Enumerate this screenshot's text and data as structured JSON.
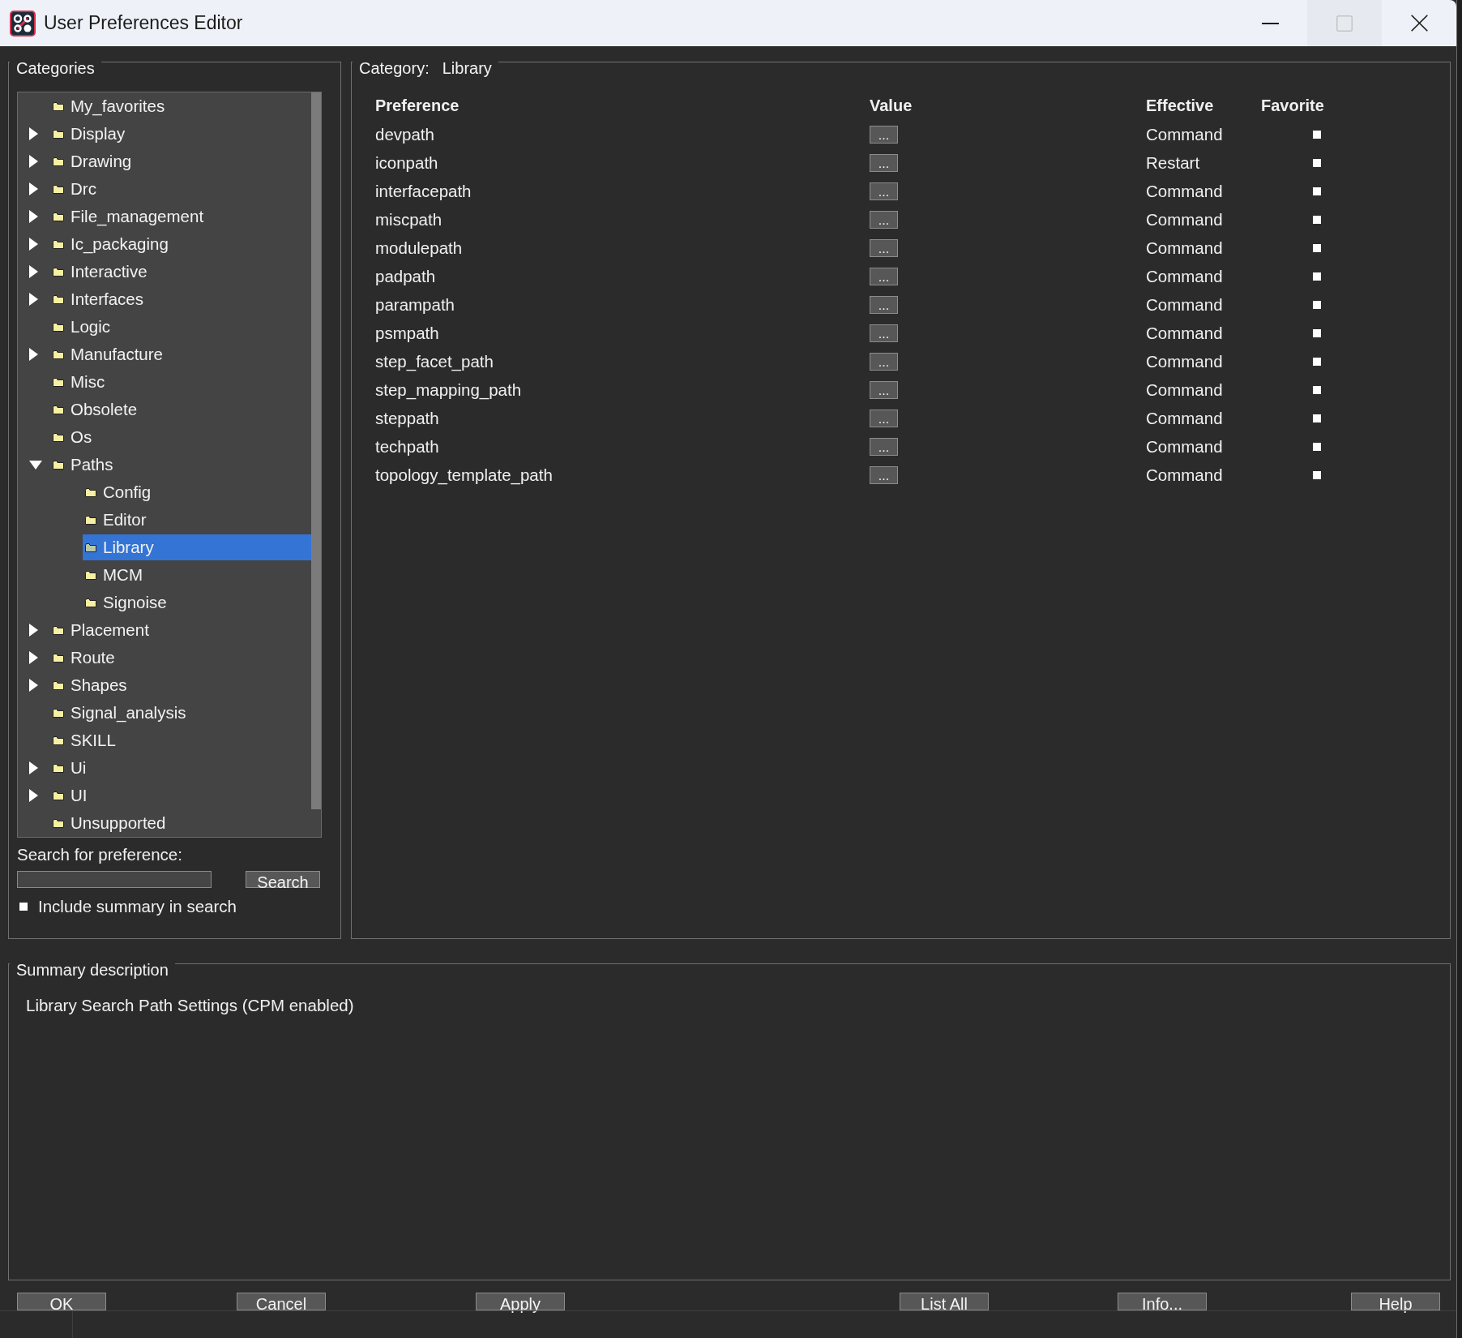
{
  "window": {
    "title": "User Preferences Editor",
    "controls": [
      {
        "kind": "minimize",
        "disabled": false
      },
      {
        "kind": "maximize",
        "disabled": true
      },
      {
        "kind": "close",
        "disabled": false
      }
    ]
  },
  "categories": {
    "title": "Categories",
    "tree": [
      {
        "label": "My_favorites",
        "selected": false
      },
      {
        "label": "Display",
        "expanded": false,
        "selected": false
      },
      {
        "label": "Drawing",
        "expanded": false,
        "selected": false
      },
      {
        "label": "Drc",
        "expanded": false,
        "selected": false
      },
      {
        "label": "File_management",
        "expanded": false,
        "selected": false
      },
      {
        "label": "Ic_packaging",
        "expanded": false,
        "selected": false
      },
      {
        "label": "Interactive",
        "expanded": false,
        "selected": false
      },
      {
        "label": "Interfaces",
        "expanded": false,
        "selected": false
      },
      {
        "label": "Logic",
        "selected": false
      },
      {
        "label": "Manufacture",
        "expanded": false,
        "selected": false
      },
      {
        "label": "Misc",
        "selected": false
      },
      {
        "label": "Obsolete",
        "selected": false
      },
      {
        "label": "Os",
        "selected": false
      },
      {
        "label": "Paths",
        "expanded": true,
        "selected": false,
        "children": [
          {
            "label": "Config",
            "selected": false
          },
          {
            "label": "Editor",
            "selected": false
          },
          {
            "label": "Library",
            "selected": true
          },
          {
            "label": "MCM",
            "selected": false
          },
          {
            "label": "Signoise",
            "selected": false
          }
        ]
      },
      {
        "label": "Placement",
        "expanded": false,
        "selected": false
      },
      {
        "label": "Route",
        "expanded": false,
        "selected": false
      },
      {
        "label": "Shapes",
        "expanded": false,
        "selected": false
      },
      {
        "label": "Signal_analysis",
        "selected": false
      },
      {
        "label": "SKILL",
        "selected": false
      },
      {
        "label": "Ui",
        "expanded": false,
        "selected": false
      },
      {
        "label": "UI",
        "expanded": false,
        "selected": false
      },
      {
        "label": "Unsupported",
        "selected": false
      }
    ]
  },
  "search": {
    "label": "Search for preference:",
    "button": "Search",
    "include_summary": {
      "label": "Include summary in search",
      "checked": false
    }
  },
  "preferences": {
    "category_label": "Category:",
    "category_value": "Library",
    "columns": [
      "Preference",
      "Value",
      "Effective",
      "Favorite"
    ],
    "rows": [
      {
        "preference": "devpath",
        "value": "...",
        "effective": "Command",
        "favorite": false
      },
      {
        "preference": "iconpath",
        "value": "...",
        "effective": "Restart",
        "favorite": false
      },
      {
        "preference": "interfacepath",
        "value": "...",
        "effective": "Command",
        "favorite": false
      },
      {
        "preference": "miscpath",
        "value": "...",
        "effective": "Command",
        "favorite": false
      },
      {
        "preference": "modulepath",
        "value": "...",
        "effective": "Command",
        "favorite": false
      },
      {
        "preference": "padpath",
        "value": "...",
        "effective": "Command",
        "favorite": false
      },
      {
        "preference": "parampath",
        "value": "...",
        "effective": "Command",
        "favorite": false
      },
      {
        "preference": "psmpath",
        "value": "...",
        "effective": "Command",
        "favorite": false
      },
      {
        "preference": "step_facet_path",
        "value": "...",
        "effective": "Command",
        "favorite": false
      },
      {
        "preference": "step_mapping_path",
        "value": "...",
        "effective": "Command",
        "favorite": false
      },
      {
        "preference": "steppath",
        "value": "...",
        "effective": "Command",
        "favorite": false
      },
      {
        "preference": "techpath",
        "value": "...",
        "effective": "Command",
        "favorite": false
      },
      {
        "preference": "topology_template_path",
        "value": "...",
        "effective": "Command",
        "favorite": false
      }
    ]
  },
  "summary": {
    "title": "Summary description",
    "text": "Library Search Path Settings (CPM enabled)"
  },
  "buttons": [
    "OK",
    "Cancel",
    "Apply",
    "List All",
    "Info...",
    "Help"
  ]
}
